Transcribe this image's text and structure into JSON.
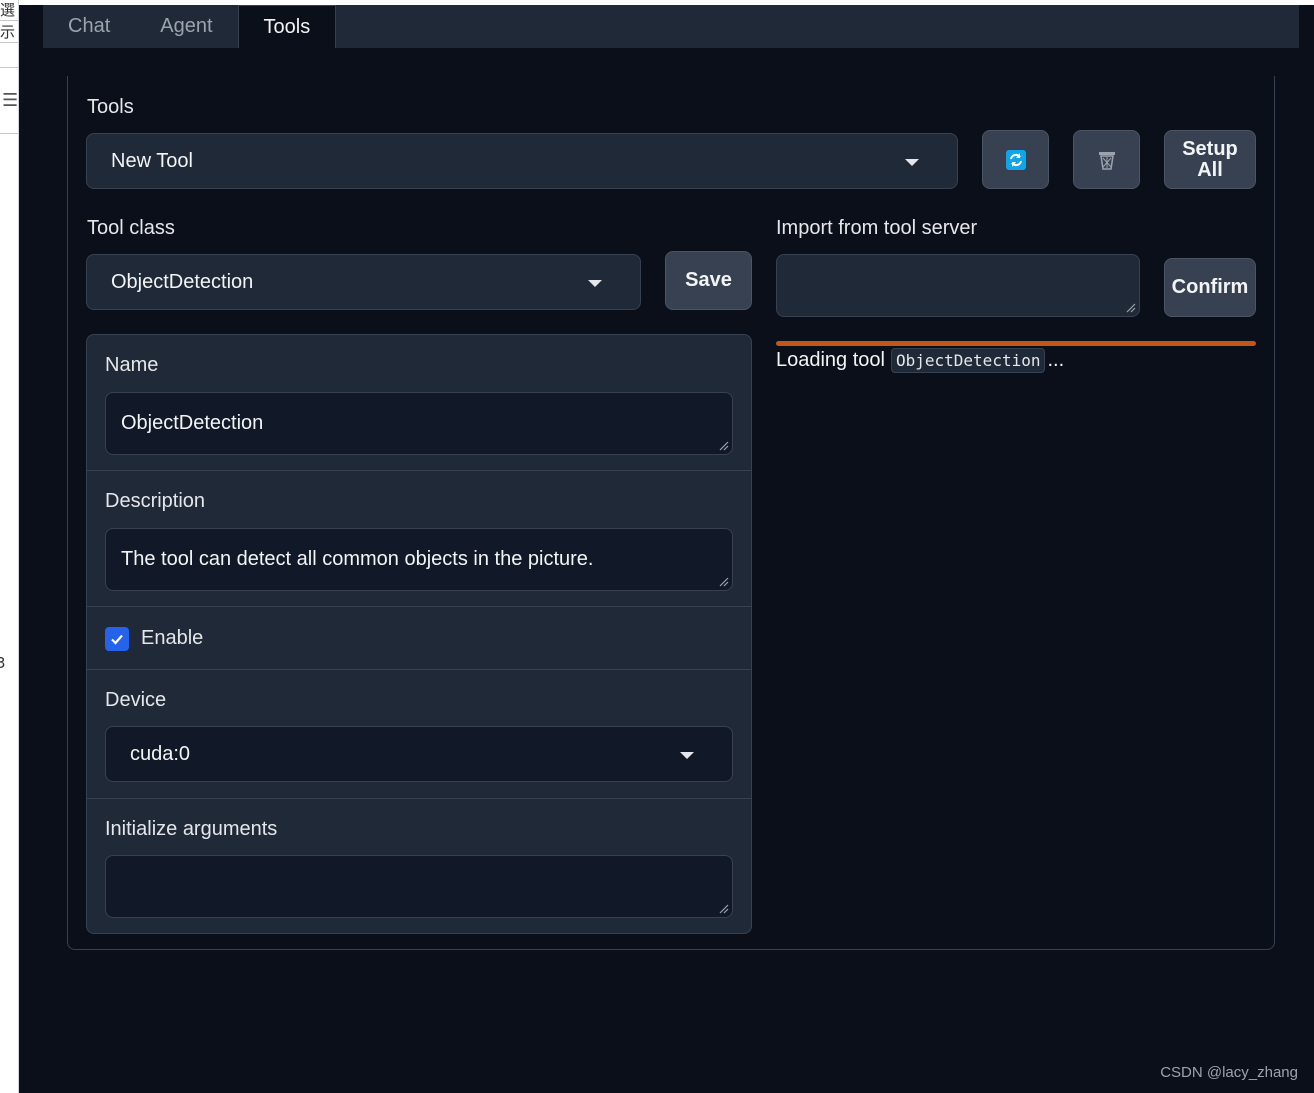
{
  "tabs": [
    {
      "label": "Chat",
      "active": false
    },
    {
      "label": "Agent",
      "active": false
    },
    {
      "label": "Tools",
      "active": true
    }
  ],
  "tools": {
    "label": "Tools",
    "selected": "New Tool",
    "refresh_icon": "refresh-icon",
    "delete_icon": "trash-icon",
    "setup_all_line1": "Setup",
    "setup_all_line2": "All"
  },
  "tool_class": {
    "label": "Tool class",
    "selected": "ObjectDetection",
    "save_label": "Save"
  },
  "import": {
    "label": "Import from tool server",
    "value": "",
    "confirm_label": "Confirm",
    "progress_color": "#c2571a",
    "status_prefix": "Loading tool",
    "status_code": "ObjectDetection",
    "status_suffix": "..."
  },
  "form": {
    "name_label": "Name",
    "name_value": "ObjectDetection",
    "description_label": "Description",
    "description_value": "The tool can detect all common objects in the picture.",
    "enable_label": "Enable",
    "enable_checked": true,
    "device_label": "Device",
    "device_value": "cuda:0",
    "init_args_label": "Initialize arguments",
    "init_args_value": ""
  },
  "watermark": "CSDN @lacy_zhang",
  "side_strip": {
    "char1": "選",
    "char2": "示",
    "char3": "3",
    "menu_icon": "menu-icon"
  },
  "colors": {
    "background": "#0b0f19",
    "surface": "#1f2937",
    "accent_checkbox": "#2563eb",
    "refresh_icon": "#0ea5e9"
  }
}
